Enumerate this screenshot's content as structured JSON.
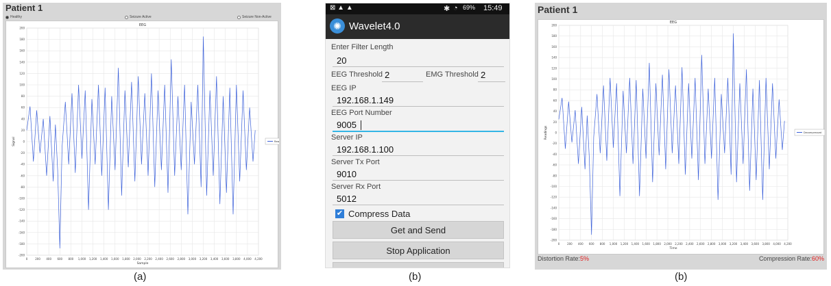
{
  "left": {
    "title": "Patient 1",
    "radios": [
      {
        "label": "Healthy",
        "selected": true
      },
      {
        "label": "Seizure Active",
        "selected": false
      },
      {
        "label": "Seizure Non-Active",
        "selected": false
      }
    ],
    "caption": "(a)"
  },
  "phone": {
    "status": {
      "bt": "✱",
      "wifi": "◔",
      "battery": "69%",
      "time": "15:49"
    },
    "app_title": "Wavelet4.0",
    "fields": {
      "filter_length_label": "Enter Filter Length",
      "filter_length_value": "20",
      "eeg_threshold_label": "EEG Threshold",
      "eeg_threshold_value": "2",
      "emg_threshold_label": "EMG Threshold",
      "emg_threshold_value": "2",
      "eeg_ip_label": "EEG IP",
      "eeg_ip_value": "192.168.1.149",
      "eeg_port_label": "EEG Port Number",
      "eeg_port_value": "9005",
      "server_ip_label": "Server IP",
      "server_ip_value": "192.168.1.100",
      "server_tx_label": "Server Tx Port",
      "server_tx_value": "9010",
      "server_rx_label": "Server Rx Port",
      "server_rx_value": "5012"
    },
    "compress_label": "Compress Data",
    "compress_checked": true,
    "buttons": {
      "get_send": "Get and Send",
      "stop": "Stop Application"
    },
    "caption": "(b)"
  },
  "right": {
    "title": "Patient 1",
    "distortion_label": "Distortion Rate:",
    "distortion_value": "5%",
    "compression_label": "Compression Rate:",
    "compression_value": "60%",
    "caption": "(b)"
  },
  "chart_data": [
    {
      "type": "line",
      "title": "EEG",
      "xlabel": "Sample",
      "ylabel": "Signal",
      "xlim": [
        0,
        4200
      ],
      "ylim": [
        -200,
        200
      ],
      "xticks": [
        "0",
        "200",
        "400",
        "600",
        "800",
        "1,000",
        "1,200",
        "1,400",
        "1,600",
        "1,800",
        "2,000",
        "2,200",
        "2,400",
        "2,600",
        "2,800",
        "3,000",
        "3,200",
        "3,400",
        "3,600",
        "3,800",
        "4,000",
        "4,200"
      ],
      "yticks": [
        "200",
        "180",
        "160",
        "140",
        "120",
        "100",
        "80",
        "60",
        "40",
        "20",
        "0",
        "-20",
        "-40",
        "-60",
        "-80",
        "-100",
        "-120",
        "-140",
        "-160",
        "-180",
        "-200"
      ],
      "grid": true,
      "legend": "right",
      "series": [
        {
          "name": "Raw",
          "color": "#3a5fd9",
          "points": [
            [
              0,
              20
            ],
            [
              60,
              62
            ],
            [
              120,
              -35
            ],
            [
              180,
              55
            ],
            [
              240,
              -20
            ],
            [
              300,
              40
            ],
            [
              360,
              -60
            ],
            [
              420,
              45
            ],
            [
              480,
              -70
            ],
            [
              520,
              30
            ],
            [
              560,
              -50
            ],
            [
              600,
              -188
            ],
            [
              640,
              -10
            ],
            [
              700,
              70
            ],
            [
              760,
              -40
            ],
            [
              820,
              85
            ],
            [
              880,
              -55
            ],
            [
              940,
              100
            ],
            [
              1000,
              -30
            ],
            [
              1060,
              90
            ],
            [
              1120,
              -120
            ],
            [
              1180,
              75
            ],
            [
              1240,
              -40
            ],
            [
              1300,
              100
            ],
            [
              1360,
              -60
            ],
            [
              1420,
              95
            ],
            [
              1480,
              -120
            ],
            [
              1540,
              80
            ],
            [
              1600,
              -50
            ],
            [
              1660,
              130
            ],
            [
              1720,
              -95
            ],
            [
              1780,
              90
            ],
            [
              1840,
              -45
            ],
            [
              1900,
              105
            ],
            [
              1960,
              -70
            ],
            [
              2020,
              115
            ],
            [
              2080,
              -40
            ],
            [
              2140,
              85
            ],
            [
              2200,
              -60
            ],
            [
              2260,
              120
            ],
            [
              2320,
              -80
            ],
            [
              2380,
              90
            ],
            [
              2440,
              -50
            ],
            [
              2500,
              100
            ],
            [
              2560,
              -90
            ],
            [
              2620,
              145
            ],
            [
              2680,
              -60
            ],
            [
              2740,
              80
            ],
            [
              2800,
              -50
            ],
            [
              2860,
              100
            ],
            [
              2920,
              -128
            ],
            [
              2980,
              70
            ],
            [
              3040,
              -40
            ],
            [
              3100,
              100
            ],
            [
              3160,
              -80
            ],
            [
              3200,
              185
            ],
            [
              3260,
              -95
            ],
            [
              3320,
              90
            ],
            [
              3380,
              -60
            ],
            [
              3440,
              115
            ],
            [
              3500,
              -110
            ],
            [
              3560,
              80
            ],
            [
              3620,
              -90
            ],
            [
              3680,
              95
            ],
            [
              3740,
              -128
            ],
            [
              3800,
              100
            ],
            [
              3860,
              -70
            ],
            [
              3920,
              90
            ],
            [
              3980,
              -50
            ],
            [
              4040,
              60
            ],
            [
              4100,
              -35
            ],
            [
              4140,
              20
            ]
          ]
        }
      ]
    },
    {
      "type": "line",
      "title": "EEG",
      "xlabel": "Time",
      "ylabel": "Readings",
      "xlim": [
        0,
        4200
      ],
      "ylim": [
        -200,
        200
      ],
      "xticks": [
        "0",
        "200",
        "400",
        "600",
        "800",
        "1,000",
        "1,200",
        "1,400",
        "1,600",
        "1,800",
        "2,000",
        "2,200",
        "2,400",
        "2,600",
        "2,800",
        "3,000",
        "3,200",
        "3,400",
        "3,600",
        "3,800",
        "4,000",
        "4,200"
      ],
      "yticks": [
        "200",
        "180",
        "160",
        "140",
        "120",
        "100",
        "80",
        "60",
        "40",
        "20",
        "0",
        "-20",
        "-40",
        "-60",
        "-80",
        "-100",
        "-120",
        "-140",
        "-160",
        "-180",
        "-200"
      ],
      "grid": true,
      "legend": "right",
      "series": [
        {
          "name": "Decompressed",
          "color": "#3a5fd9",
          "points": [
            [
              0,
              25
            ],
            [
              60,
              65
            ],
            [
              120,
              -30
            ],
            [
              180,
              58
            ],
            [
              240,
              -18
            ],
            [
              300,
              42
            ],
            [
              360,
              -58
            ],
            [
              420,
              48
            ],
            [
              480,
              -68
            ],
            [
              520,
              32
            ],
            [
              560,
              -48
            ],
            [
              600,
              -190
            ],
            [
              640,
              -8
            ],
            [
              700,
              72
            ],
            [
              760,
              -38
            ],
            [
              820,
              88
            ],
            [
              880,
              -52
            ],
            [
              940,
              102
            ],
            [
              1000,
              -28
            ],
            [
              1060,
              92
            ],
            [
              1120,
              -118
            ],
            [
              1180,
              78
            ],
            [
              1240,
              -38
            ],
            [
              1300,
              102
            ],
            [
              1360,
              -58
            ],
            [
              1420,
              98
            ],
            [
              1480,
              -118
            ],
            [
              1540,
              82
            ],
            [
              1600,
              -48
            ],
            [
              1660,
              130
            ],
            [
              1720,
              -92
            ],
            [
              1780,
              92
            ],
            [
              1840,
              -42
            ],
            [
              1900,
              108
            ],
            [
              1960,
              -68
            ],
            [
              2020,
              118
            ],
            [
              2080,
              -38
            ],
            [
              2140,
              88
            ],
            [
              2200,
              -58
            ],
            [
              2260,
              122
            ],
            [
              2320,
              -78
            ],
            [
              2380,
              92
            ],
            [
              2440,
              -48
            ],
            [
              2500,
              102
            ],
            [
              2560,
              -88
            ],
            [
              2620,
              145
            ],
            [
              2680,
              -58
            ],
            [
              2740,
              82
            ],
            [
              2800,
              -48
            ],
            [
              2860,
              102
            ],
            [
              2920,
              -125
            ],
            [
              2980,
              72
            ],
            [
              3040,
              -38
            ],
            [
              3100,
              102
            ],
            [
              3160,
              -78
            ],
            [
              3200,
              185
            ],
            [
              3260,
              -92
            ],
            [
              3320,
              92
            ],
            [
              3380,
              -58
            ],
            [
              3440,
              118
            ],
            [
              3500,
              -108
            ],
            [
              3560,
              82
            ],
            [
              3620,
              -88
            ],
            [
              3680,
              98
            ],
            [
              3740,
              -125
            ],
            [
              3800,
              102
            ],
            [
              3860,
              -68
            ],
            [
              3920,
              92
            ],
            [
              3980,
              -48
            ],
            [
              4040,
              62
            ],
            [
              4100,
              -32
            ],
            [
              4140,
              22
            ]
          ]
        }
      ]
    }
  ]
}
